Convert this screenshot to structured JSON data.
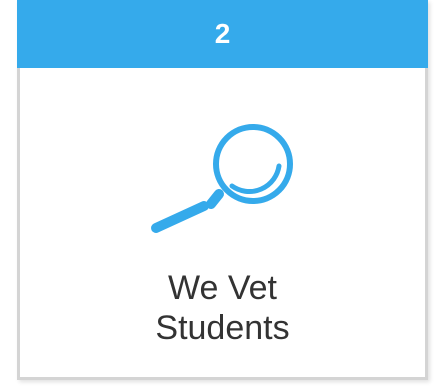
{
  "card": {
    "step_number": "2",
    "title": "We Vet\nStudents",
    "icon": "magnifying-glass-icon",
    "colors": {
      "accent": "#35aaeb",
      "border": "#d4d4d4",
      "text": "#333333",
      "background": "#ffffff"
    }
  }
}
